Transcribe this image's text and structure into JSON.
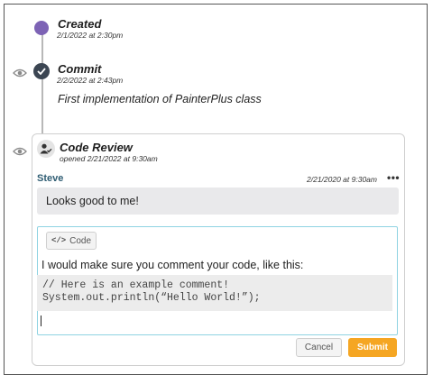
{
  "colors": {
    "created_dot": "#7d63b5",
    "commit_check_bg": "#3b4552",
    "author": "#2f5d73",
    "editor_border": "#8fd3e2",
    "submit_bg": "#f5a623"
  },
  "timeline": {
    "created": {
      "title": "Created",
      "meta": "2/1/2022 at 2:30pm"
    },
    "commit": {
      "title": "Commit",
      "meta": "2/2/2022 at 2:43pm",
      "description": "First implementation of PainterPlus class"
    },
    "code_review": {
      "title": "Code Review",
      "meta": "opened 2/21/2022 at 9:30am"
    }
  },
  "comment": {
    "author": "Steve",
    "date": "2/21/2020 at 9:30am",
    "more": "•••",
    "body": "Looks good to me!"
  },
  "editor": {
    "code_button_label": "Code",
    "code_button_icon": "</>",
    "text": "I would make sure you comment your code, like this:",
    "code_lines": [
      "// Here is an example comment!",
      "System.out.println(“Hello World!”);"
    ]
  },
  "actions": {
    "cancel": "Cancel",
    "submit": "Submit"
  }
}
